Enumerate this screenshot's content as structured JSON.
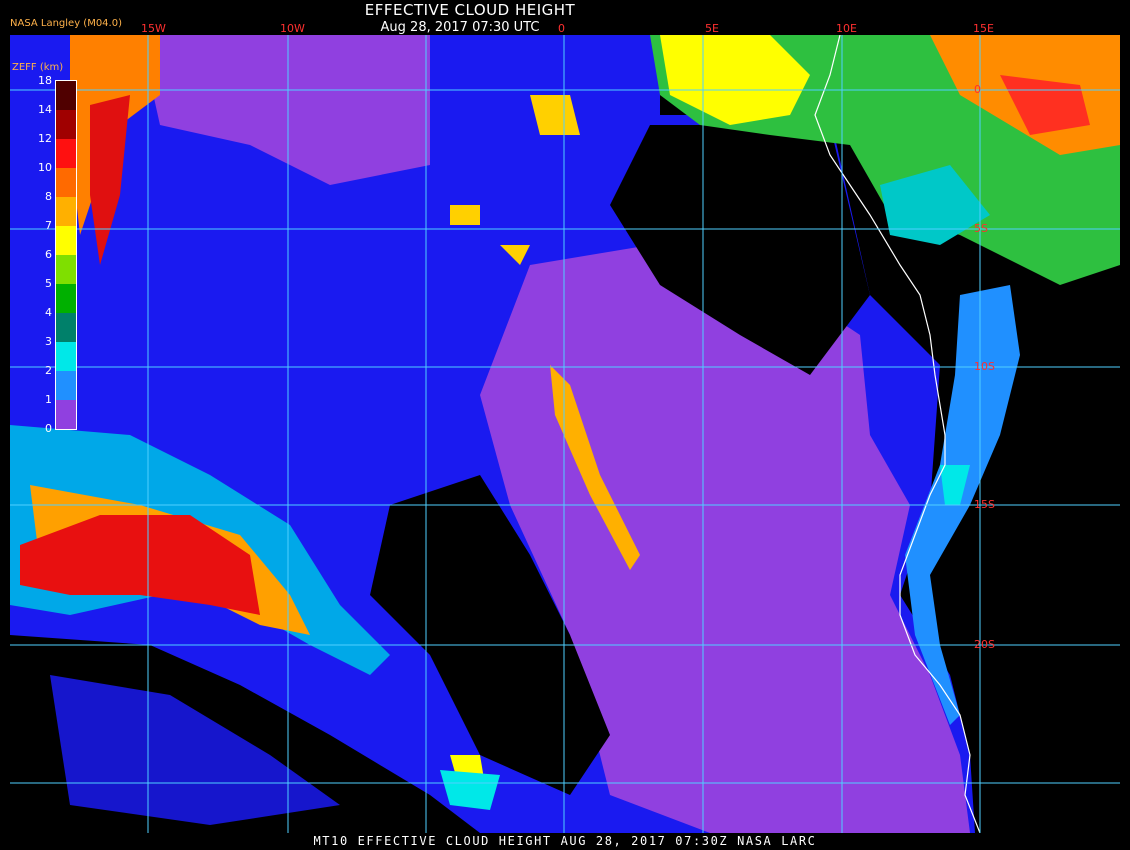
{
  "header": {
    "credit": "NASA Langley (M04.0)",
    "title": "EFFECTIVE CLOUD HEIGHT",
    "time": "Aug 28, 2017 07:30 UTC"
  },
  "footer": "MT10  EFFECTIVE CLOUD HEIGHT   AUG 28, 2017 07:30Z   NASA LARC",
  "legend": {
    "title": "ZEFF (km)",
    "labels": [
      "18",
      "14",
      "12",
      "10",
      "8",
      "7",
      "6",
      "5",
      "4",
      "3",
      "2",
      "1",
      "0"
    ],
    "colors": [
      "#500000",
      "#a00000",
      "#ff1010",
      "#ff6a00",
      "#ffb000",
      "#ffff00",
      "#7fdf00",
      "#00b000",
      "#00806a",
      "#00e8e8",
      "#2090ff",
      "#1020ff",
      "#9040e0"
    ]
  },
  "grid": {
    "lon_labels": [
      "15W",
      "10W",
      "0",
      "5E",
      "10E",
      "15E"
    ],
    "lat_labels": [
      "0",
      "5S",
      "10S",
      "15S",
      "20S"
    ]
  },
  "colors": {
    "background": "#000000",
    "grid": "#4fd0ff",
    "label": "#ff3030",
    "coast": "#ffffff"
  }
}
